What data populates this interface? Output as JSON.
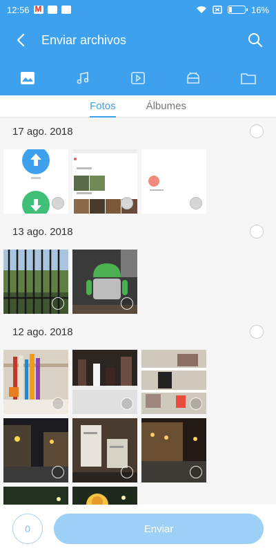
{
  "status_bar": {
    "time": "12:56",
    "battery_text": "16%",
    "battery_level": 0.16
  },
  "header": {
    "title": "Enviar archivos"
  },
  "category_tabs": [
    {
      "name": "photos",
      "icon": "image-icon",
      "active": true
    },
    {
      "name": "music",
      "icon": "music-icon",
      "active": false
    },
    {
      "name": "videos",
      "icon": "video-icon",
      "active": false
    },
    {
      "name": "apps",
      "icon": "android-icon",
      "active": false
    },
    {
      "name": "files",
      "icon": "folder-icon",
      "active": false
    }
  ],
  "sub_tabs": {
    "fotos": "Fotos",
    "albumes": "Álbumes",
    "active": "fotos"
  },
  "groups": [
    {
      "date": "17 ago. 2018",
      "photo_count": 3
    },
    {
      "date": "13 ago. 2018",
      "photo_count": 2
    },
    {
      "date": "12 ago. 2018",
      "photo_count": 8
    }
  ],
  "bottom_bar": {
    "count": "0",
    "send_label": "Enviar"
  },
  "colors": {
    "primary": "#3ea1ee",
    "send_disabled": "#9cd0f6"
  }
}
